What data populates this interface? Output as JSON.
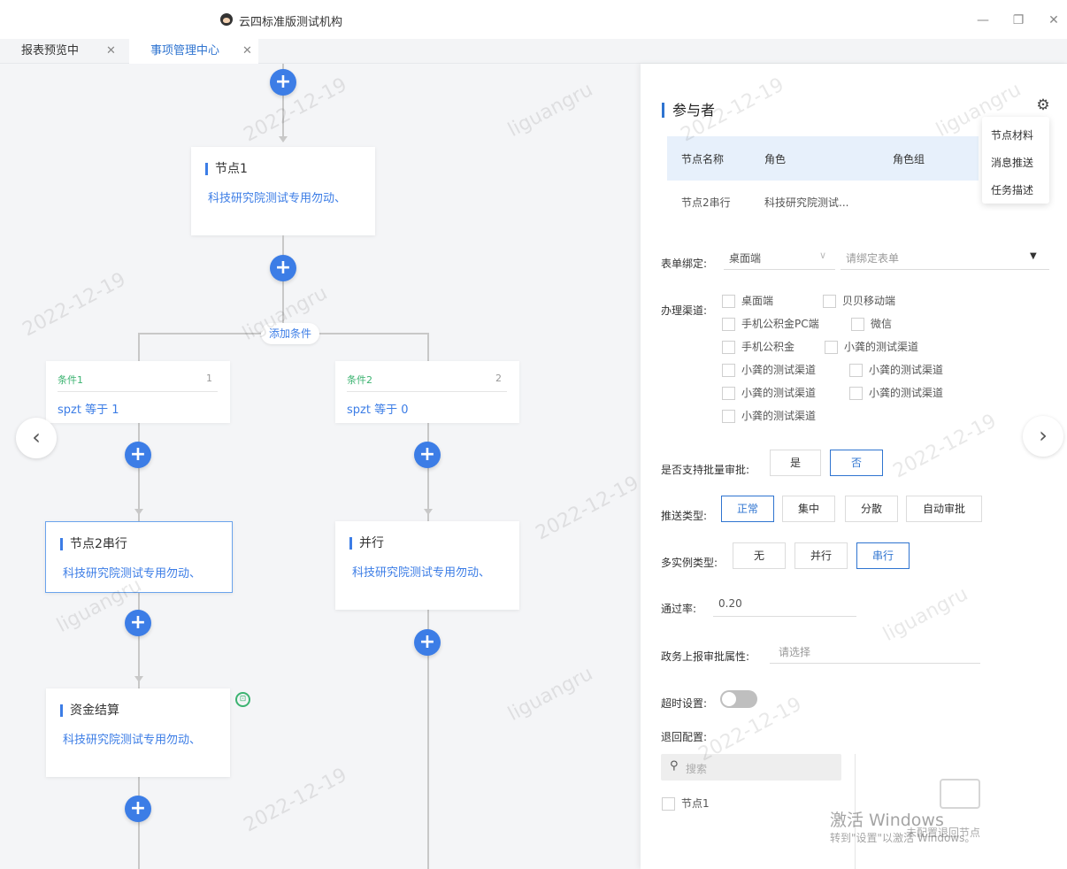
{
  "window": {
    "title": "云四标准版测试机构",
    "minimize": "—",
    "restore": "❐",
    "close": "✕"
  },
  "tabs": [
    {
      "label": "报表预览中",
      "close": "✕"
    },
    {
      "label": "事项管理中心",
      "close": "✕"
    }
  ],
  "flow": {
    "add_symbol": "+",
    "add_condition_label": "添加条件",
    "node1": {
      "title": "节点1",
      "desc": "科技研究院测试专用勿动、"
    },
    "cond1": {
      "name": "条件1",
      "priority": "1",
      "expr": "spzt 等于 1"
    },
    "cond2": {
      "name": "条件2",
      "priority": "2",
      "expr": "spzt 等于 0"
    },
    "node2": {
      "title": "节点2串行",
      "desc": "科技研究院测试专用勿动、"
    },
    "node_parallel": {
      "title": "并行",
      "desc": "科技研究院测试专用勿动、"
    },
    "node_fund": {
      "title": "资金结算",
      "desc": "科技研究院测试专用勿动、"
    },
    "prev_arrow": "‹",
    "next_arrow": "›"
  },
  "panel": {
    "heading": "参与者",
    "settings_icon": "gear-icon",
    "table": {
      "headers": [
        "节点名称",
        "角色",
        "角色组"
      ],
      "row": [
        "节点2串行",
        "科技研究院测试..."
      ]
    },
    "settings_menu": [
      "节点材料",
      "消息推送",
      "任务描述"
    ],
    "form_binding": {
      "label": "表单绑定:",
      "terminal": "桌面端",
      "placeholder": "请绑定表单"
    },
    "channels": {
      "label": "办理渠道:",
      "options": [
        "桌面端",
        "贝贝移动端",
        "手机公积金PC端",
        "微信",
        "手机公积金",
        "小龚的测试渠道",
        "小龚的测试渠道",
        "小龚的测试渠道",
        "小龚的测试渠道",
        "小龚的测试渠道",
        "小龚的测试渠道"
      ]
    },
    "batch": {
      "label": "是否支持批量审批:",
      "options": [
        "是",
        "否"
      ],
      "selected": "否"
    },
    "push_type": {
      "label": "推送类型:",
      "options": [
        "正常",
        "集中",
        "分散",
        "自动审批"
      ],
      "selected": "正常"
    },
    "multi_instance": {
      "label": "多实例类型:",
      "options": [
        "无",
        "并行",
        "串行"
      ],
      "selected": "串行"
    },
    "pass_rate": {
      "label": "通过率:",
      "value": "0.20"
    },
    "gov_attr": {
      "label": "政务上报审批属性:",
      "placeholder": "请选择"
    },
    "timeout": {
      "label": "超时设置:"
    },
    "return_config": {
      "label": "退回配置:",
      "search_placeholder": "搜索",
      "item": "节点1",
      "empty_text": "未配置退回节点"
    },
    "accent": "#2f74d0"
  },
  "watermark": {
    "text1": "liguangru",
    "text2": "2022-12-19"
  },
  "activation": {
    "line1": "激活 Windows",
    "line2": "转到\"设置\"以激活 Windows。"
  }
}
